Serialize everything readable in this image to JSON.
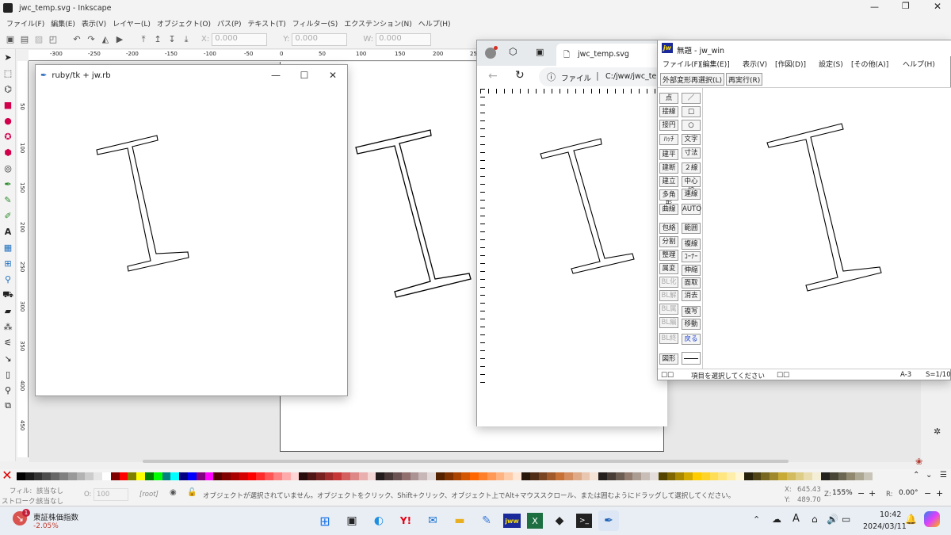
{
  "inkscape": {
    "title": "jwc_temp.svg - Inkscape",
    "menu": [
      "ファイル(F)",
      "編集(E)",
      "表示(V)",
      "レイヤー(L)",
      "オブジェクト(O)",
      "パス(P)",
      "テキスト(T)",
      "フィルター(S)",
      "エクステンション(N)",
      "ヘルプ(H)"
    ],
    "toolbar": {
      "x_label": "X:",
      "x_value": "0.000",
      "y_label": "Y:",
      "y_value": "0.000",
      "w_label": "W:",
      "w_value": "0.000"
    },
    "ruler_h": [
      "-300",
      "-250",
      "-200",
      "-150",
      "-100",
      "-50",
      "0",
      "50",
      "100",
      "150",
      "200",
      "250"
    ],
    "ruler_v": [
      "50",
      "100",
      "150",
      "200",
      "250",
      "300",
      "350",
      "400",
      "450"
    ],
    "status": {
      "fill_label": "フィル:",
      "fill_value": "該当なし",
      "stroke_label": "ストローク:",
      "stroke_value": "該当なし",
      "opacity_label": "O:",
      "opacity_value": "100",
      "layer": "[root]",
      "message": "オブジェクトが選択されていません。オブジェクトをクリック、Shift+クリック、オブジェクト上でAlt+マウススクロール、または囲むようにドラッグして選択してください。",
      "x_label": "X:",
      "x_value": "645.43",
      "y_label": "Y:",
      "y_value": "489.70",
      "zoom_label": "Z:",
      "zoom_value": "155%",
      "rot_label": "R:",
      "rot_value": "0.00°"
    },
    "palette": [
      "#000000",
      "#1a1a1a",
      "#333333",
      "#4d4d4d",
      "#666666",
      "#808080",
      "#999999",
      "#b3b3b3",
      "#cccccc",
      "#e6e6e6",
      "#ffffff",
      "#800000",
      "#ff0000",
      "#808000",
      "#ffff00",
      "#008000",
      "#00ff00",
      "#008080",
      "#00ffff",
      "#000080",
      "#0000ff",
      "#800080",
      "#ff00ff",
      "#550000",
      "#800000",
      "#aa0000",
      "#d40000",
      "#ff0000",
      "#ff2a2a",
      "#ff5555",
      "#ff8080",
      "#ffaaaa",
      "#ffd5d5",
      "#280b0b",
      "#501616",
      "#782121",
      "#a02c2c",
      "#c83737",
      "#d35f5f",
      "#de8787",
      "#e9afaf",
      "#f4d7d7",
      "#241c1c",
      "#483737",
      "#6c5353",
      "#916f6f",
      "#ac9393",
      "#c8b7b7",
      "#e3dbdb",
      "#552200",
      "#803300",
      "#aa4400",
      "#d45500",
      "#ff6600",
      "#ff7f2a",
      "#ff9955",
      "#ffb380",
      "#ffccaa",
      "#ffe6d5",
      "#28170b",
      "#502d16",
      "#784421",
      "#a05a2c",
      "#c87137",
      "#d38d5f",
      "#deaa87",
      "#e9c6af",
      "#f4e3d7",
      "#241f1c",
      "#483e37",
      "#6c5d53",
      "#917c6f",
      "#ac9d93",
      "#c8beb7",
      "#e3dedb",
      "#554400",
      "#806600",
      "#aa8800",
      "#d4aa00",
      "#ffcc00",
      "#ffd42a",
      "#ffdd55",
      "#ffe680",
      "#ffeeaa",
      "#fff6d5",
      "#28220b",
      "#504416",
      "#786721",
      "#a0892c",
      "#c8ab37",
      "#d3bc5f",
      "#decd87",
      "#e9ddaf",
      "#f4eed7",
      "#24221c",
      "#484537",
      "#6c6753",
      "#91896f",
      "#aca793",
      "#c8c4b7"
    ]
  },
  "tk": {
    "title": "ruby/tk + jw.rb",
    "min": "—",
    "max": "☐",
    "close": "✕"
  },
  "browser": {
    "tab_title": "jwc_temp.svg",
    "file_label": "ファイル",
    "url": "C:/jww/jwc_te"
  },
  "jw": {
    "title": "無題 - jw_win",
    "logo": "jw",
    "menu": [
      "ファイル(F)",
      "[編集(E)]",
      "表示(V)",
      "[作図(D)]",
      "設定(S)",
      "[その他(A)]",
      "ヘルプ(H)"
    ],
    "cmd1": "外部変形再選択(L)",
    "cmd2": "再実行(R)",
    "left": [
      "点",
      "接線",
      "接円",
      "ﾊｯﾁ",
      "建平",
      "建断",
      "建立",
      "多角形",
      "曲線",
      "包絡",
      "分割",
      "整理",
      "属変",
      "BL化",
      "BL解",
      "BL属",
      "BL編",
      "BL終",
      "図形"
    ],
    "right": [
      "／",
      "□",
      "○",
      "文字",
      "寸法",
      "２線",
      "中心線",
      "連線",
      "AUTO",
      "範囲",
      "複線",
      "ｺｰﾅｰ",
      "伸縮",
      "面取",
      "消去",
      "複写",
      "移動",
      "戻る"
    ],
    "status_left": "□□",
    "status_msg": "項目を選択してください",
    "status_mid": "□□",
    "status_a": "A-3",
    "status_s": "S=1/10"
  },
  "taskbar": {
    "stock_name": "東証株価指数",
    "stock_change": "-2.05%",
    "badge": "1",
    "time": "10:42",
    "date": "2024/03/11",
    "ime": "A"
  }
}
